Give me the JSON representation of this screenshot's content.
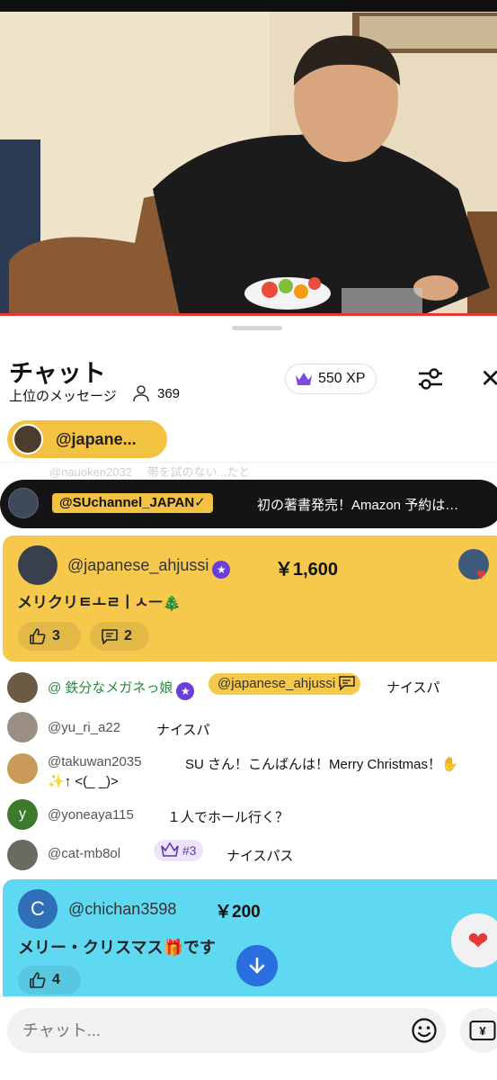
{
  "video": {
    "description_icon": "live-video-frame"
  },
  "chat": {
    "title": "チャット",
    "filter_label": "上位のメッセージ",
    "viewer_count": "369",
    "xp_label": "550 XP"
  },
  "pinned": {
    "handle": "@japane..."
  },
  "faded_row": {
    "text": "@nauoken2032 　帯を試のない...たと"
  },
  "ticker": {
    "handle": "@SUchannel_JAPAN✓",
    "message": "初の著書発売！Amazon 予約は…"
  },
  "superchat_gold": {
    "user": "@japanese_ahjussi",
    "amount": "￥1,600",
    "message": "メリクリㅌㅗㄹㅣㅅㅡ🎄",
    "likes": "3",
    "replies": "2"
  },
  "messages": [
    {
      "user": "@ 鉄分なメガネっ娘",
      "reply_to": "@japanese_ahjussi",
      "text": "ナイスパ",
      "avatar_color": "#6b5a44"
    },
    {
      "user": "@yu_ri_a22",
      "text": "ナイスパ",
      "avatar_color": "#9a8f82"
    },
    {
      "user": "@takuwan2035",
      "text": "SU さん！こんばんは！Merry Christmas！✋",
      "text2": "✨↑ <(_ _)>",
      "avatar_color": "#c99a5a"
    },
    {
      "user": "@yoneaya115",
      "text": "１人でホール行く？",
      "avatar_letter": "y",
      "avatar_color": "#3c7a2e"
    },
    {
      "user": "@cat-mb8ol",
      "rank": "#3",
      "text": "ナイスパス",
      "avatar_color": "#6b6a5e"
    }
  ],
  "superchat_blue": {
    "avatar_letter": "C",
    "user": "@chichan3598",
    "amount": "￥200",
    "message": "メリー・クリスマス🎁です",
    "likes": "4"
  },
  "input": {
    "placeholder": "チャット..."
  },
  "colors": {
    "gold": "#f6c94d",
    "blue": "#5fd9f2",
    "accent_red": "#e53935",
    "scroll_blue": "#2a6fe0",
    "verified_purple": "#6a3fd8"
  }
}
